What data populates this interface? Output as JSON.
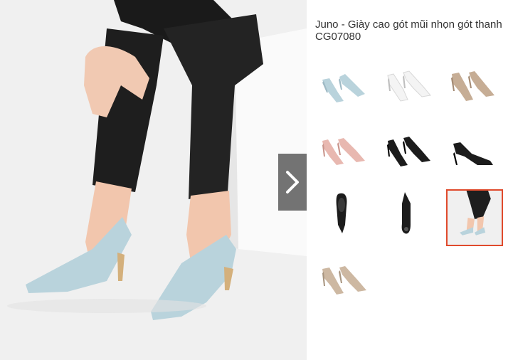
{
  "product": {
    "title": "Juno - Giày cao gót mũi nhọn gót thanh CG07080"
  },
  "gallery": {
    "main_image": "model-wearing-light-blue-pumps",
    "next_icon": "chevron-right-icon",
    "selected_index": 8,
    "thumbnails": [
      {
        "name": "light-blue-pair"
      },
      {
        "name": "white-pair"
      },
      {
        "name": "taupe-pair"
      },
      {
        "name": "pink-pair"
      },
      {
        "name": "black-pair"
      },
      {
        "name": "black-single-side"
      },
      {
        "name": "black-top-view"
      },
      {
        "name": "black-sole-view"
      },
      {
        "name": "model-photo"
      },
      {
        "name": "beige-pair"
      }
    ]
  },
  "colors": {
    "accent": "#e04a2c",
    "text": "#333333",
    "light_blue": "#b9d3dc",
    "white": "#f4f4f4",
    "taupe": "#c6ad95",
    "pink": "#e8b8b0",
    "black": "#1c1c1c",
    "beige": "#cdb8a2",
    "pants": "#1e1e1e"
  }
}
